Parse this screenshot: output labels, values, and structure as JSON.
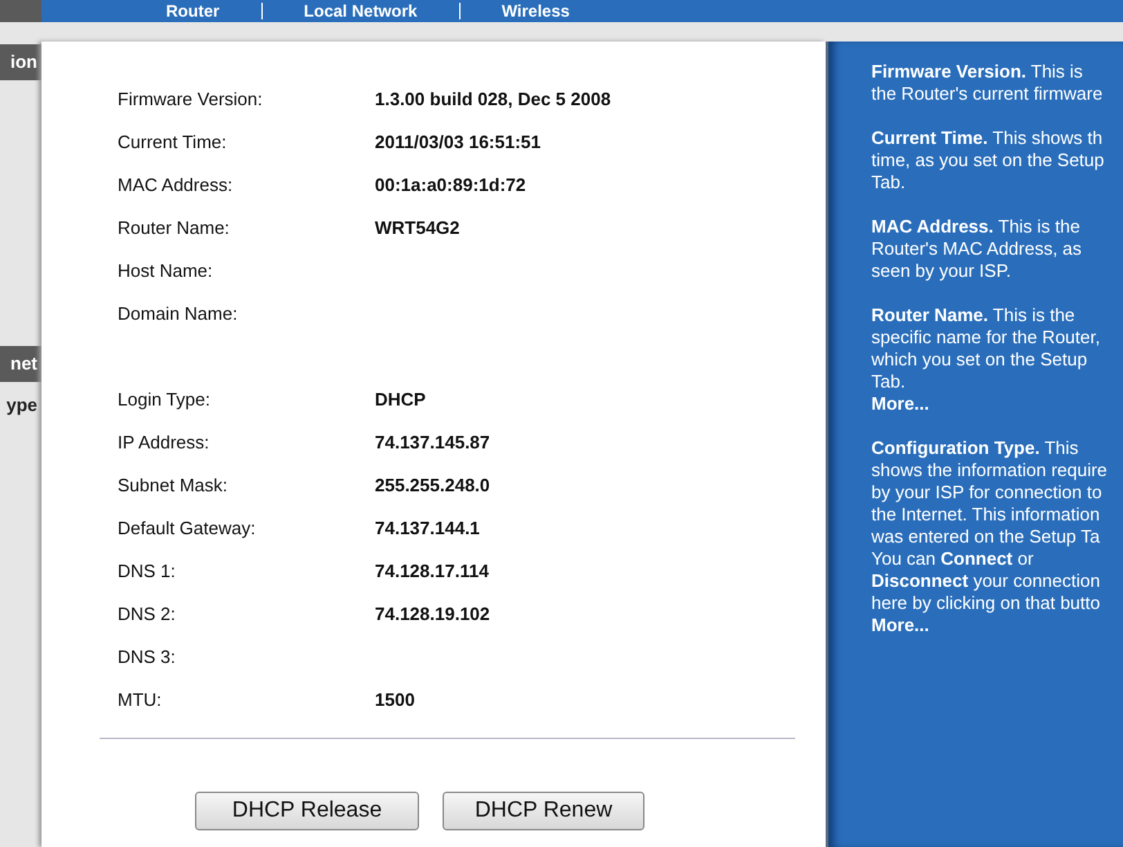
{
  "top_nav": {
    "items": [
      {
        "label": "Router",
        "selected": false
      },
      {
        "label": "Local Network",
        "selected": false
      },
      {
        "label": "Wireless",
        "selected": false
      }
    ]
  },
  "left_menu": [
    {
      "label": "ion",
      "kind": "header"
    },
    {
      "label": "net",
      "kind": "header"
    },
    {
      "label": "ype",
      "kind": "item"
    }
  ],
  "status_rows": [
    {
      "kind": "field",
      "label": "Firmware Version:",
      "value": "1.3.00 build 028, Dec 5 2008"
    },
    {
      "kind": "field",
      "label": "Current Time:",
      "value": "2011/03/03 16:51:51"
    },
    {
      "kind": "field",
      "label": "MAC Address:",
      "value": "00:1a:a0:89:1d:72"
    },
    {
      "kind": "field",
      "label": "Router Name:",
      "value": "WRT54G2"
    },
    {
      "kind": "field",
      "label": "Host Name:"
    },
    {
      "kind": "field",
      "label": "Domain Name:"
    },
    {
      "kind": "spacer"
    },
    {
      "kind": "field",
      "label": "Login Type:",
      "value": "DHCP"
    },
    {
      "kind": "field",
      "label": "IP Address:",
      "value": "74.137.145.87"
    },
    {
      "kind": "field",
      "label": "Subnet Mask:",
      "value": "255.255.248.0"
    },
    {
      "kind": "field",
      "label": "Default Gateway:",
      "value": "74.137.144.1"
    },
    {
      "kind": "field",
      "label": "DNS 1:",
      "value": "74.128.17.114"
    },
    {
      "kind": "field",
      "label": "DNS 2:",
      "value": "74.128.19.102"
    },
    {
      "kind": "field",
      "label": "DNS 3:"
    },
    {
      "kind": "field",
      "label": "MTU:",
      "value": "1500"
    }
  ],
  "buttons": [
    "DHCP Release",
    "DHCP Renew"
  ],
  "help": [
    {
      "lines": [
        "**Firmware Version.** This is",
        "the Router's current firmware"
      ]
    },
    {
      "lines": [
        "**Current Time.** This shows th",
        "time, as you set on the Setup",
        "Tab."
      ]
    },
    {
      "lines": [
        "**MAC Address.** This is the",
        "Router's MAC Address, as",
        "seen by your ISP."
      ]
    },
    {
      "lines": [
        "**Router Name.** This is the",
        "specific name for the Router,",
        "which you set on the Setup",
        "Tab."
      ],
      "more": "More..."
    },
    {
      "lines": [
        "**Configuration Type.** This",
        "shows the information require",
        "by your ISP for connection to",
        "the Internet. This information",
        "was entered on the Setup Ta",
        "You can **Connect** or",
        "**Disconnect** your connection",
        "here by clicking on that butto"
      ],
      "more": "More..."
    }
  ]
}
